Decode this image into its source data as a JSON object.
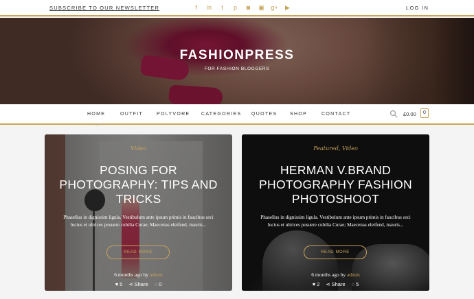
{
  "topbar": {
    "newsletter": "SUBSCRIBE TO OUR NEWSLETTER",
    "login": "LOG IN",
    "socials": [
      {
        "icon": "facebook-icon",
        "glyph": "f"
      },
      {
        "icon": "linkedin-icon",
        "glyph": "in"
      },
      {
        "icon": "twitter-icon",
        "glyph": "t"
      },
      {
        "icon": "pinterest-icon",
        "glyph": "p"
      },
      {
        "icon": "instagram-icon",
        "glyph": "◙"
      },
      {
        "icon": "flickr-icon",
        "glyph": "▣"
      },
      {
        "icon": "googleplus-icon",
        "glyph": "g+"
      },
      {
        "icon": "youtube-icon",
        "glyph": "▶"
      }
    ]
  },
  "hero": {
    "title": "FASHIONPRESS",
    "tagline": "FOR FASHION BLOGGERS"
  },
  "nav": {
    "items": [
      "HOME",
      "OUTFIT",
      "POLYVORE",
      "CATEGORIES",
      "QUOTES",
      "SHOP",
      "CONTACT"
    ],
    "cart_total": "£0.00",
    "cart_count": "0"
  },
  "posts": [
    {
      "category": "Video",
      "title": "POSING FOR PHOTOGRAPHY: TIPS AND TRICKS",
      "excerpt": "Phasellus in dignissim ligula. Vestibulum ante ipsum primis in faucibus orci luctus et ultrices posuere cubilia Curae; Maecenas eleifend, mauris...",
      "read_more": "READ MORE",
      "time": "6 months ago by",
      "author": "admin",
      "likes": "5",
      "share": "Share",
      "comments": "0"
    },
    {
      "category": "Featured, Video",
      "title": "HERMAN V.BRAND PHOTOGRAPHY FASHION PHOTOSHOOT",
      "excerpt": "Phasellus in dignissim ligula. Vestibulum ante ipsum primis in faucibus orci luctus et ultrices posuere cubilia Curae; Maecenas eleifend, mauris...",
      "read_more": "READ MORE",
      "time": "6 months ago by",
      "author": "admin",
      "likes": "2",
      "share": "Share",
      "comments": "5"
    }
  ],
  "colors": {
    "accent": "#c8a45a",
    "text": "#333333"
  }
}
